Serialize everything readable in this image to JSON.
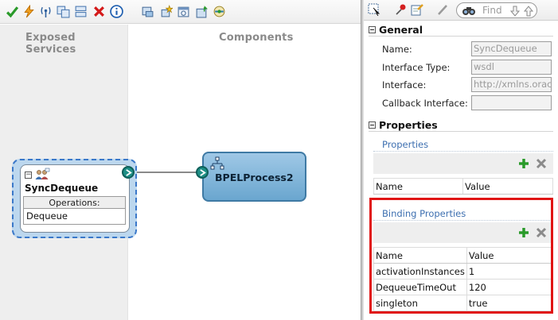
{
  "editor": {
    "toolbar_icons": [
      "check-icon",
      "lightning-icon",
      "antenna-icon",
      "copy-icon",
      "paste-icon",
      "delete-icon",
      "info-icon",
      "database-icon",
      "wizard-icon",
      "calendar-icon",
      "deploy-icon",
      "test-icon"
    ],
    "exposed_services_title": "Exposed Services",
    "components_title": "Components",
    "service": {
      "name": "SyncDequeue",
      "operations_header": "Operations:",
      "operations": [
        "Dequeue"
      ]
    },
    "component": {
      "name": "BPELProcess2"
    }
  },
  "inspector": {
    "find_placeholder": "Find",
    "general": {
      "title": "General",
      "fields": [
        {
          "label": "Name:",
          "value": "SyncDequeue"
        },
        {
          "label": "Interface Type:",
          "value": "wsdl"
        },
        {
          "label": "Interface:",
          "value": "http://xmlns.orac"
        },
        {
          "label": "Callback Interface:",
          "value": ""
        }
      ]
    },
    "properties": {
      "title": "Properties",
      "sub_title": "Properties",
      "columns": [
        "Name",
        "Value"
      ],
      "rows": []
    },
    "binding_properties": {
      "title": "Binding Properties",
      "columns": [
        "Name",
        "Value"
      ],
      "rows": [
        {
          "name": "activationInstances",
          "value": "1"
        },
        {
          "name": "DequeueTimeOut",
          "value": "120"
        },
        {
          "name": "singleton",
          "value": "true"
        }
      ]
    }
  },
  "colors": {
    "highlight": "#e01414",
    "component_fill": "#6aa6cf",
    "service_dashed": "#3a78c9",
    "subsection_title": "#3d6fb0"
  }
}
